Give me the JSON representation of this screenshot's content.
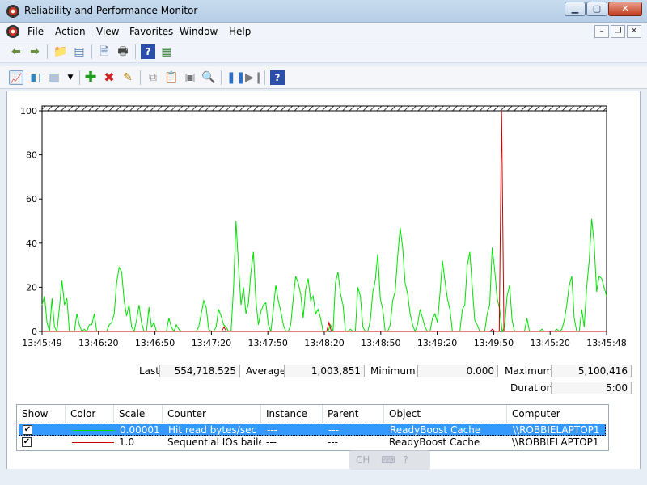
{
  "window": {
    "title": "Reliability and Performance Monitor"
  },
  "menu": [
    "File",
    "Action",
    "View",
    "Favorites",
    "Window",
    "Help"
  ],
  "chart_data": {
    "type": "line",
    "title": "",
    "xlabel": "",
    "ylabel": "",
    "ylim": [
      0,
      100
    ],
    "yticks": [
      "100",
      "80",
      "60",
      "40",
      "20",
      "0"
    ],
    "xticks": [
      "13:45:49",
      "13:46:20",
      "13:46:50",
      "13:47:20",
      "13:47:50",
      "13:48:20",
      "13:48:50",
      "13:49:20",
      "13:49:50",
      "13:45:20",
      "13:45:48"
    ],
    "grid": false,
    "series": [
      {
        "name": "Hit read bytes/sec",
        "color": "#00e000",
        "values": [
          12,
          16,
          4,
          0,
          15,
          2,
          0,
          11,
          23,
          12,
          15,
          0,
          0,
          0,
          8,
          3,
          0,
          1,
          0,
          3,
          3,
          8,
          0,
          0,
          0,
          0,
          0,
          3,
          4,
          8,
          22,
          29,
          27,
          14,
          7,
          12,
          2,
          0,
          5,
          12,
          4,
          0,
          0,
          11,
          2,
          4,
          0,
          0,
          0,
          0,
          0,
          6,
          2,
          0,
          3,
          1,
          0,
          0,
          0,
          0,
          0,
          0,
          0,
          2,
          8,
          14,
          11,
          1,
          0,
          0,
          2,
          10,
          7,
          3,
          2,
          0,
          0,
          20,
          50,
          30,
          12,
          20,
          8,
          13,
          27,
          36,
          14,
          3,
          9,
          12,
          13,
          3,
          0,
          10,
          21,
          14,
          9,
          3,
          0,
          0,
          3,
          15,
          25,
          22,
          17,
          6,
          19,
          24,
          14,
          16,
          8,
          10,
          6,
          0,
          0,
          0,
          3,
          0,
          22,
          27,
          17,
          12,
          0,
          0,
          1,
          0,
          0,
          20,
          16,
          2,
          0,
          0,
          5,
          18,
          23,
          35,
          15,
          10,
          0,
          0,
          3,
          14,
          18,
          34,
          47,
          38,
          22,
          17,
          8,
          3,
          0,
          3,
          10,
          6,
          2,
          0,
          0,
          6,
          8,
          4,
          17,
          32,
          23,
          15,
          10,
          0,
          0,
          0,
          0,
          10,
          12,
          30,
          36,
          20,
          5,
          3,
          0,
          0,
          0,
          8,
          12,
          38,
          28,
          15,
          10,
          0,
          2,
          16,
          21,
          5,
          0,
          0,
          0,
          0,
          0,
          6,
          0,
          0,
          0,
          0,
          0,
          1,
          0,
          0,
          0,
          0,
          0,
          1,
          0,
          1,
          5,
          12,
          21,
          25,
          6,
          0,
          0,
          10,
          2,
          20,
          32,
          51,
          40,
          18,
          25,
          24,
          20,
          16
        ]
      },
      {
        "name": "Sequential IOs bailed out",
        "color": "#cc0000",
        "values": [
          0,
          0,
          0,
          0,
          0,
          0,
          0,
          0,
          0,
          0,
          0,
          0,
          0,
          0,
          0,
          0,
          0,
          0,
          0,
          0,
          0,
          0,
          0,
          0,
          0,
          0,
          0,
          0,
          0,
          0,
          0,
          0,
          0,
          0,
          0,
          0,
          0,
          0,
          0,
          0,
          0,
          0,
          0,
          0,
          0,
          0,
          0,
          0,
          0,
          0,
          0,
          0,
          0,
          0,
          0,
          0,
          0,
          0,
          0,
          0,
          0,
          0,
          0,
          0,
          0,
          0,
          0,
          0,
          0,
          0,
          0,
          0,
          0,
          0,
          0,
          0,
          0,
          0,
          2,
          0,
          0,
          0,
          0,
          0,
          0,
          0,
          0,
          0,
          0,
          0,
          0,
          0,
          0,
          0,
          0,
          0,
          0,
          0,
          0,
          0,
          0,
          0,
          0,
          0,
          0,
          0,
          0,
          0,
          0,
          0,
          0,
          0,
          0,
          0,
          0,
          0,
          0,
          0,
          0,
          0,
          0,
          0,
          0,
          4,
          0,
          0,
          0,
          0,
          0,
          0,
          0,
          0,
          0,
          0,
          0,
          0,
          0,
          0,
          0,
          0,
          0,
          0,
          0,
          0,
          0,
          0,
          0,
          0,
          0,
          0,
          0,
          0,
          0,
          0,
          0,
          0,
          0,
          0,
          0,
          0,
          0,
          0,
          0,
          0,
          0,
          0,
          0,
          0,
          0,
          0,
          0,
          0,
          0,
          0,
          0,
          0,
          0,
          0,
          0,
          0,
          0,
          0,
          0,
          0,
          0,
          0,
          0,
          0,
          0,
          0,
          0,
          0,
          0,
          1,
          0,
          0,
          0,
          100,
          0,
          0,
          0,
          0,
          0,
          0,
          0,
          0,
          0,
          0,
          0,
          0,
          0,
          0,
          0,
          0,
          0,
          0,
          0,
          0,
          0,
          0,
          0,
          0,
          0,
          0,
          0,
          0,
          0,
          0,
          0,
          0,
          0,
          0,
          0,
          0,
          0,
          0,
          0,
          0,
          0,
          0,
          0,
          0,
          0
        ]
      }
    ]
  },
  "stats": {
    "last_label": "Last",
    "last": "554,718.525",
    "average_label": "Average",
    "average": "1,003,851",
    "minimum_label": "Minimum",
    "minimum": "0.000",
    "maximum_label": "Maximum",
    "maximum": "5,100,416",
    "duration_label": "Duration",
    "duration": "5:00"
  },
  "legend": {
    "columns": [
      "Show",
      "Color",
      "Scale",
      "Counter",
      "Instance",
      "Parent",
      "Object",
      "Computer"
    ],
    "rows": [
      {
        "show": "✔",
        "color": "#00e000",
        "scale": "0.00001",
        "counter": "Hit read bytes/sec",
        "instance": "---",
        "parent": "---",
        "object": "ReadyBoost Cache",
        "computer": "\\\\ROBBIELAPTOP1"
      },
      {
        "show": "✔",
        "color": "#cc0000",
        "scale": "1.0",
        "counter": "Sequential IOs baile...",
        "instance": "---",
        "parent": "---",
        "object": "ReadyBoost Cache",
        "computer": "\\\\ROBBIELAPTOP1"
      }
    ]
  },
  "langbar": {
    "text": "CH"
  }
}
